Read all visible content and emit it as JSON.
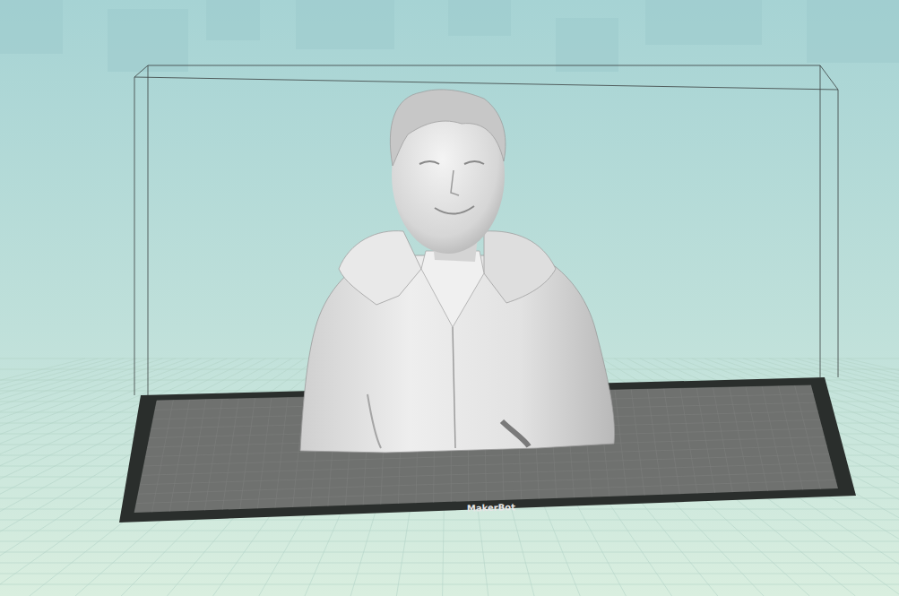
{
  "plate": {
    "brand": "MakerBot"
  }
}
